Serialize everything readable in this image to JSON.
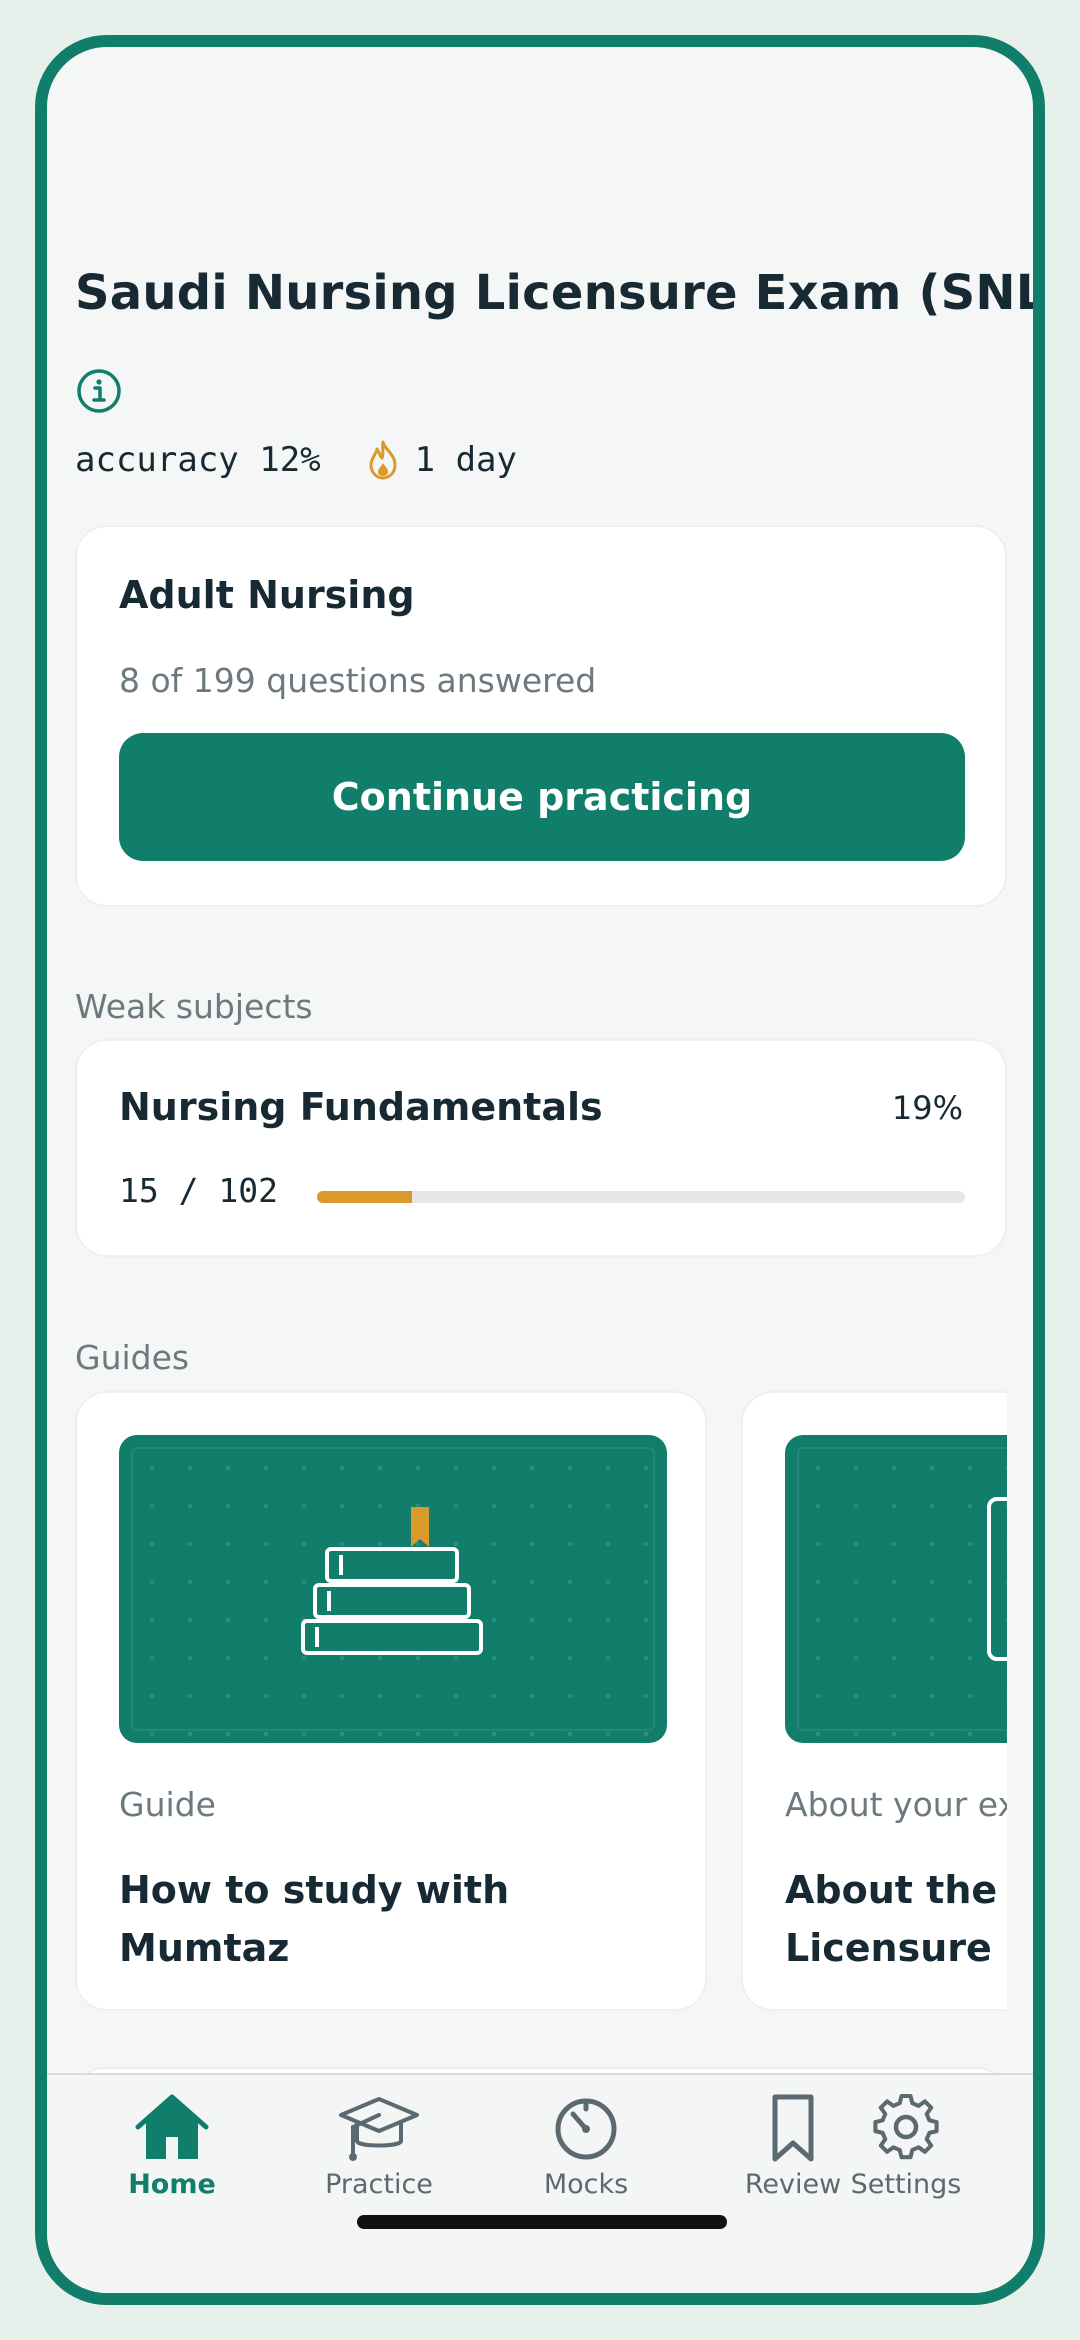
{
  "header": {
    "title": "Saudi Nursing Licensure Exam (SNLE)",
    "accuracy_text": "accuracy 12%",
    "streak_text": "1 day"
  },
  "continue_card": {
    "title": "Adult Nursing",
    "progress_text": "8 of 199 questions answered",
    "button_label": "Continue practicing"
  },
  "weak_subjects": {
    "label": "Weak subjects",
    "items": [
      {
        "name": "Nursing Fundamentals",
        "percent": "19%",
        "count_text": "15 / 102",
        "progress": 0.147
      }
    ]
  },
  "guides": {
    "label": "Guides",
    "items": [
      {
        "kicker": "Guide",
        "title": "How to study with Mumtaz"
      },
      {
        "kicker": "About your exam",
        "title": "About the Saudi Nursing Licensure Exam"
      }
    ]
  },
  "tabbar": {
    "items": [
      {
        "label": "Home",
        "icon": "home-icon",
        "active": true
      },
      {
        "label": "Practice",
        "icon": "graduation-cap-icon",
        "active": false
      },
      {
        "label": "Mocks",
        "icon": "timer-icon",
        "active": false
      },
      {
        "label": "Review",
        "icon": "bookmark-icon",
        "active": false
      },
      {
        "label": "Settings",
        "icon": "gear-icon",
        "active": false
      }
    ]
  },
  "colors": {
    "accent": "#117e6b",
    "warning": "#d99a2b",
    "text": "#172a33",
    "muted": "#6c7a80"
  }
}
